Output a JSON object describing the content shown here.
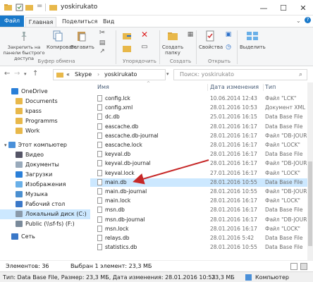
{
  "window": {
    "title": "yoskirukato"
  },
  "ribbon_tabs": {
    "file": "Файл",
    "home": "Главная",
    "share": "Поделиться",
    "view": "Вид"
  },
  "ribbon": {
    "pin_label": "Закрепить на панели быстрого доступа",
    "copy_label": "Копировать",
    "paste_label": "Вставить",
    "clipboard_group": "Буфер обмена",
    "organize_group": "Упорядочить",
    "new_folder_label": "Создать папку",
    "create_group": "Создать",
    "properties_label": "Свойства",
    "open_group": "Открыть",
    "select_label": "Выделить"
  },
  "address": {
    "crumbs": [
      "«",
      "Skype",
      "yoskirukato"
    ],
    "search_placeholder": "Поиск: yoskirukato"
  },
  "nav": {
    "onedrive": "OneDrive",
    "onedrive_children": [
      "Documents",
      "kpass",
      "Programms",
      "Work"
    ],
    "this_pc": "Этот компьютер",
    "pc_children": [
      "Видео",
      "Документы",
      "Загрузки",
      "Изображения",
      "Музыка",
      "Рабочий стол",
      "Локальный диск (C:)",
      "Public (\\\\sf-fs) (F:)"
    ],
    "network": "Сеть"
  },
  "columns": {
    "name": "Имя",
    "date": "Дата изменения",
    "type": "Тип"
  },
  "files": [
    {
      "name": "config.lck",
      "date": "10.06.2014 12:43",
      "type": "Файл \"LCK\""
    },
    {
      "name": "config.xml",
      "date": "28.01.2016 10:53",
      "type": "Документ XML"
    },
    {
      "name": "dc.db",
      "date": "25.01.2016 16:15",
      "type": "Data Base File"
    },
    {
      "name": "eascache.db",
      "date": "28.01.2016 16:17",
      "type": "Data Base File"
    },
    {
      "name": "eascache.db-journal",
      "date": "28.01.2016 16:17",
      "type": "Файл \"DB-JOURN"
    },
    {
      "name": "eascache.lock",
      "date": "28.01.2016 16:17",
      "type": "Файл \"LOCK\""
    },
    {
      "name": "keyval.db",
      "date": "28.01.2016 16:17",
      "type": "Data Base File"
    },
    {
      "name": "keyval.db-journal",
      "date": "28.01.2016 16:17",
      "type": "Файл \"DB-JOURN"
    },
    {
      "name": "keyval.lock",
      "date": "27.01.2016 16:17",
      "type": "Файл \"LOCK\""
    },
    {
      "name": "main.db",
      "date": "28.01.2016 10:55",
      "type": "Data Base File"
    },
    {
      "name": "main.db-journal",
      "date": "28.01.2016 10:55",
      "type": "Файл \"DB-JOURN"
    },
    {
      "name": "main.lock",
      "date": "28.01.2016 16:17",
      "type": "Файл \"LOCK\""
    },
    {
      "name": "msn.db",
      "date": "28.01.2016 16:17",
      "type": "Data Base File"
    },
    {
      "name": "msn.db-journal",
      "date": "28.01.2016 16:17",
      "type": "Файл \"DB-JOURN"
    },
    {
      "name": "msn.lock",
      "date": "28.01.2016 16:17",
      "type": "Файл \"LOCK\""
    },
    {
      "name": "relays.db",
      "date": "28.01.2016 5:42",
      "type": "Data Base File"
    },
    {
      "name": "statistics.db",
      "date": "28.01.2016 10:55",
      "type": "Data Base File"
    }
  ],
  "status": {
    "count": "Элементов: 36",
    "selected": "Выбран 1 элемент: 23,3 МБ"
  },
  "infobar": {
    "details": "Тип: Data Base File, Размер: 23,3 МБ, Дата изменения: 28.01.2016 10:53",
    "size": "23,3 МБ",
    "location": "Компьютер"
  },
  "colors": {
    "accent": "#1979ca",
    "selection": "#cce8ff",
    "arrow": "#c62828"
  }
}
